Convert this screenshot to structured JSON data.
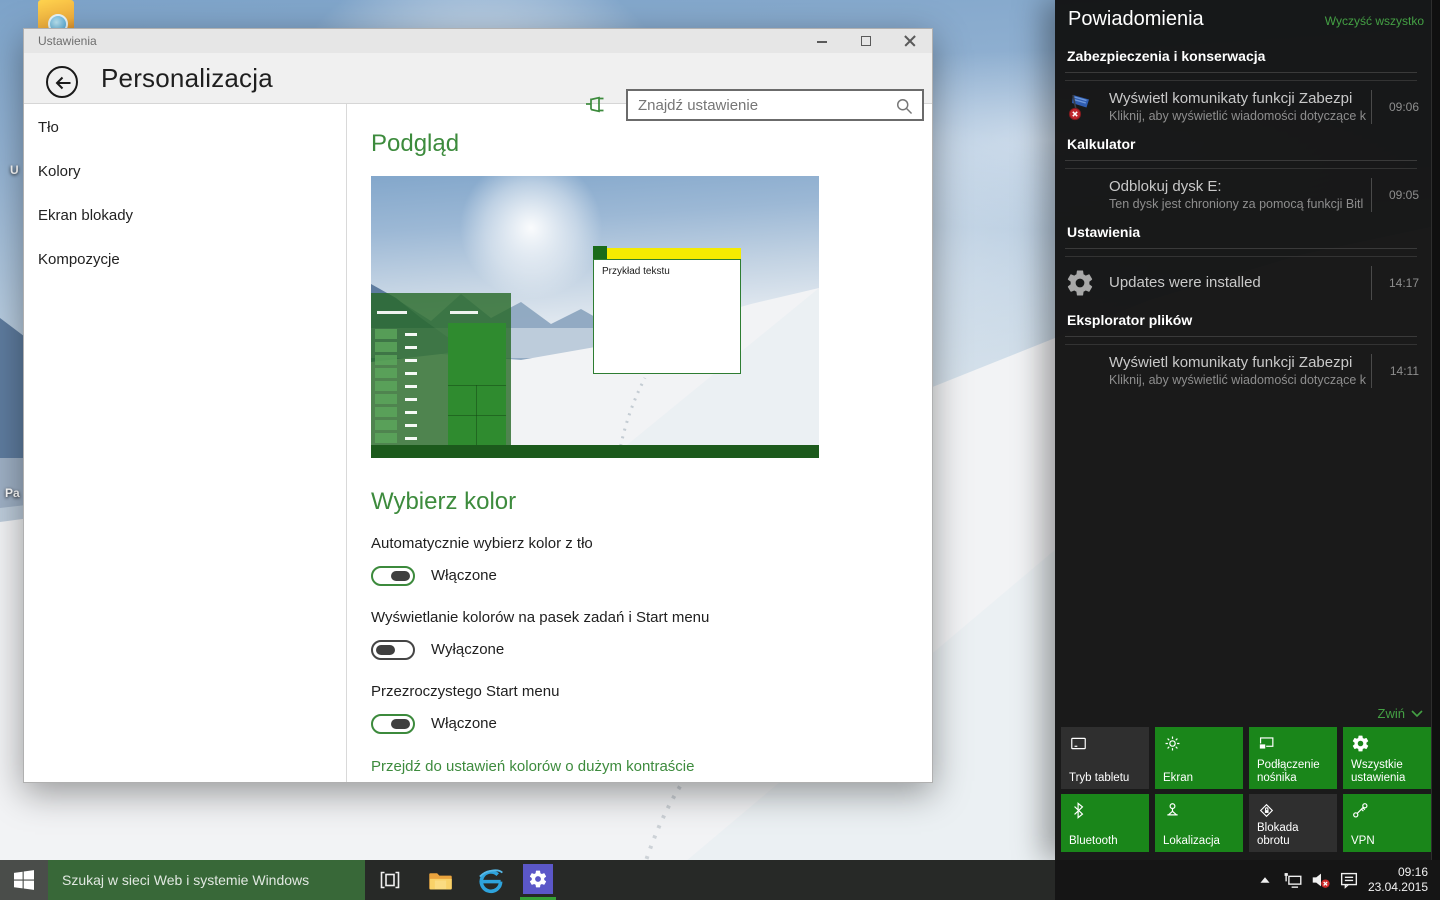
{
  "colors": {
    "accent_green": "#1a861a",
    "heading_green": "#3d8b3d",
    "link_green": "#44a044",
    "taskbar_search_green": "#386838",
    "settings_icon_purple": "#5b57c8",
    "sample_titlebar_yellow": "#f5eb00",
    "tile_dark": "#2f2f2f"
  },
  "desktop": {
    "partial_label_top": "U",
    "partial_label_bottom": "Pa"
  },
  "settings_window": {
    "titlebar_title": "Ustawienia",
    "page_title": "Personalizacja",
    "search_placeholder": "Znajdź ustawienie",
    "nav": [
      {
        "label": "Tło"
      },
      {
        "label": "Kolory"
      },
      {
        "label": "Ekran blokady"
      },
      {
        "label": "Kompozycje"
      }
    ],
    "preview": {
      "heading": "Podgląd",
      "sample_window_text": "Przykład tekstu"
    },
    "color_section": {
      "heading": "Wybierz kolor",
      "toggles": [
        {
          "label": "Automatycznie wybierz kolor z tło",
          "state": "Włączone"
        },
        {
          "label": "Wyświetlanie kolorów na pasek zadań i Start menu",
          "state": "Wyłączone"
        },
        {
          "label": "Przezroczystego Start menu",
          "state": "Włączone"
        }
      ],
      "contrast_link": "Przejdź do ustawień kolorów o dużym kontraście"
    }
  },
  "action_center": {
    "title": "Powiadomienia",
    "clear_all": "Wyczyść wszystko",
    "groups": [
      {
        "app": "Zabezpieczenia i konserwacja",
        "title": "Wyświetl komunikaty funkcji Zabezpi",
        "time": "09:06",
        "subtitle": "Kliknij, aby wyświetlić wiadomości dotyczące k"
      },
      {
        "app": "Kalkulator",
        "title": "Odblokuj dysk E:",
        "time": "09:05",
        "subtitle": "Ten dysk jest chroniony za pomocą funkcji Bitl"
      },
      {
        "app": "Ustawienia",
        "title": "Updates were installed",
        "time": "14:17",
        "subtitle": ""
      },
      {
        "app": "Eksplorator plików",
        "title": "Wyświetl komunikaty funkcji Zabezpi",
        "time": "14:11",
        "subtitle": "Kliknij, aby wyświetlić wiadomości dotyczące k"
      }
    ],
    "collapse_label": "Zwiń",
    "tiles": [
      {
        "label": "Tryb tabletu"
      },
      {
        "label": "Ekran"
      },
      {
        "label": "Podłączenie nośnika"
      },
      {
        "label": "Wszystkie ustawienia"
      },
      {
        "label": "Bluetooth"
      },
      {
        "label": "Lokalizacja"
      },
      {
        "label": "Blokada obrotu"
      },
      {
        "label": "VPN"
      }
    ]
  },
  "taskbar": {
    "search_placeholder": "Szukaj w sieci Web i systemie Windows",
    "clock_time": "09:16",
    "clock_date": "23.04.2015"
  }
}
